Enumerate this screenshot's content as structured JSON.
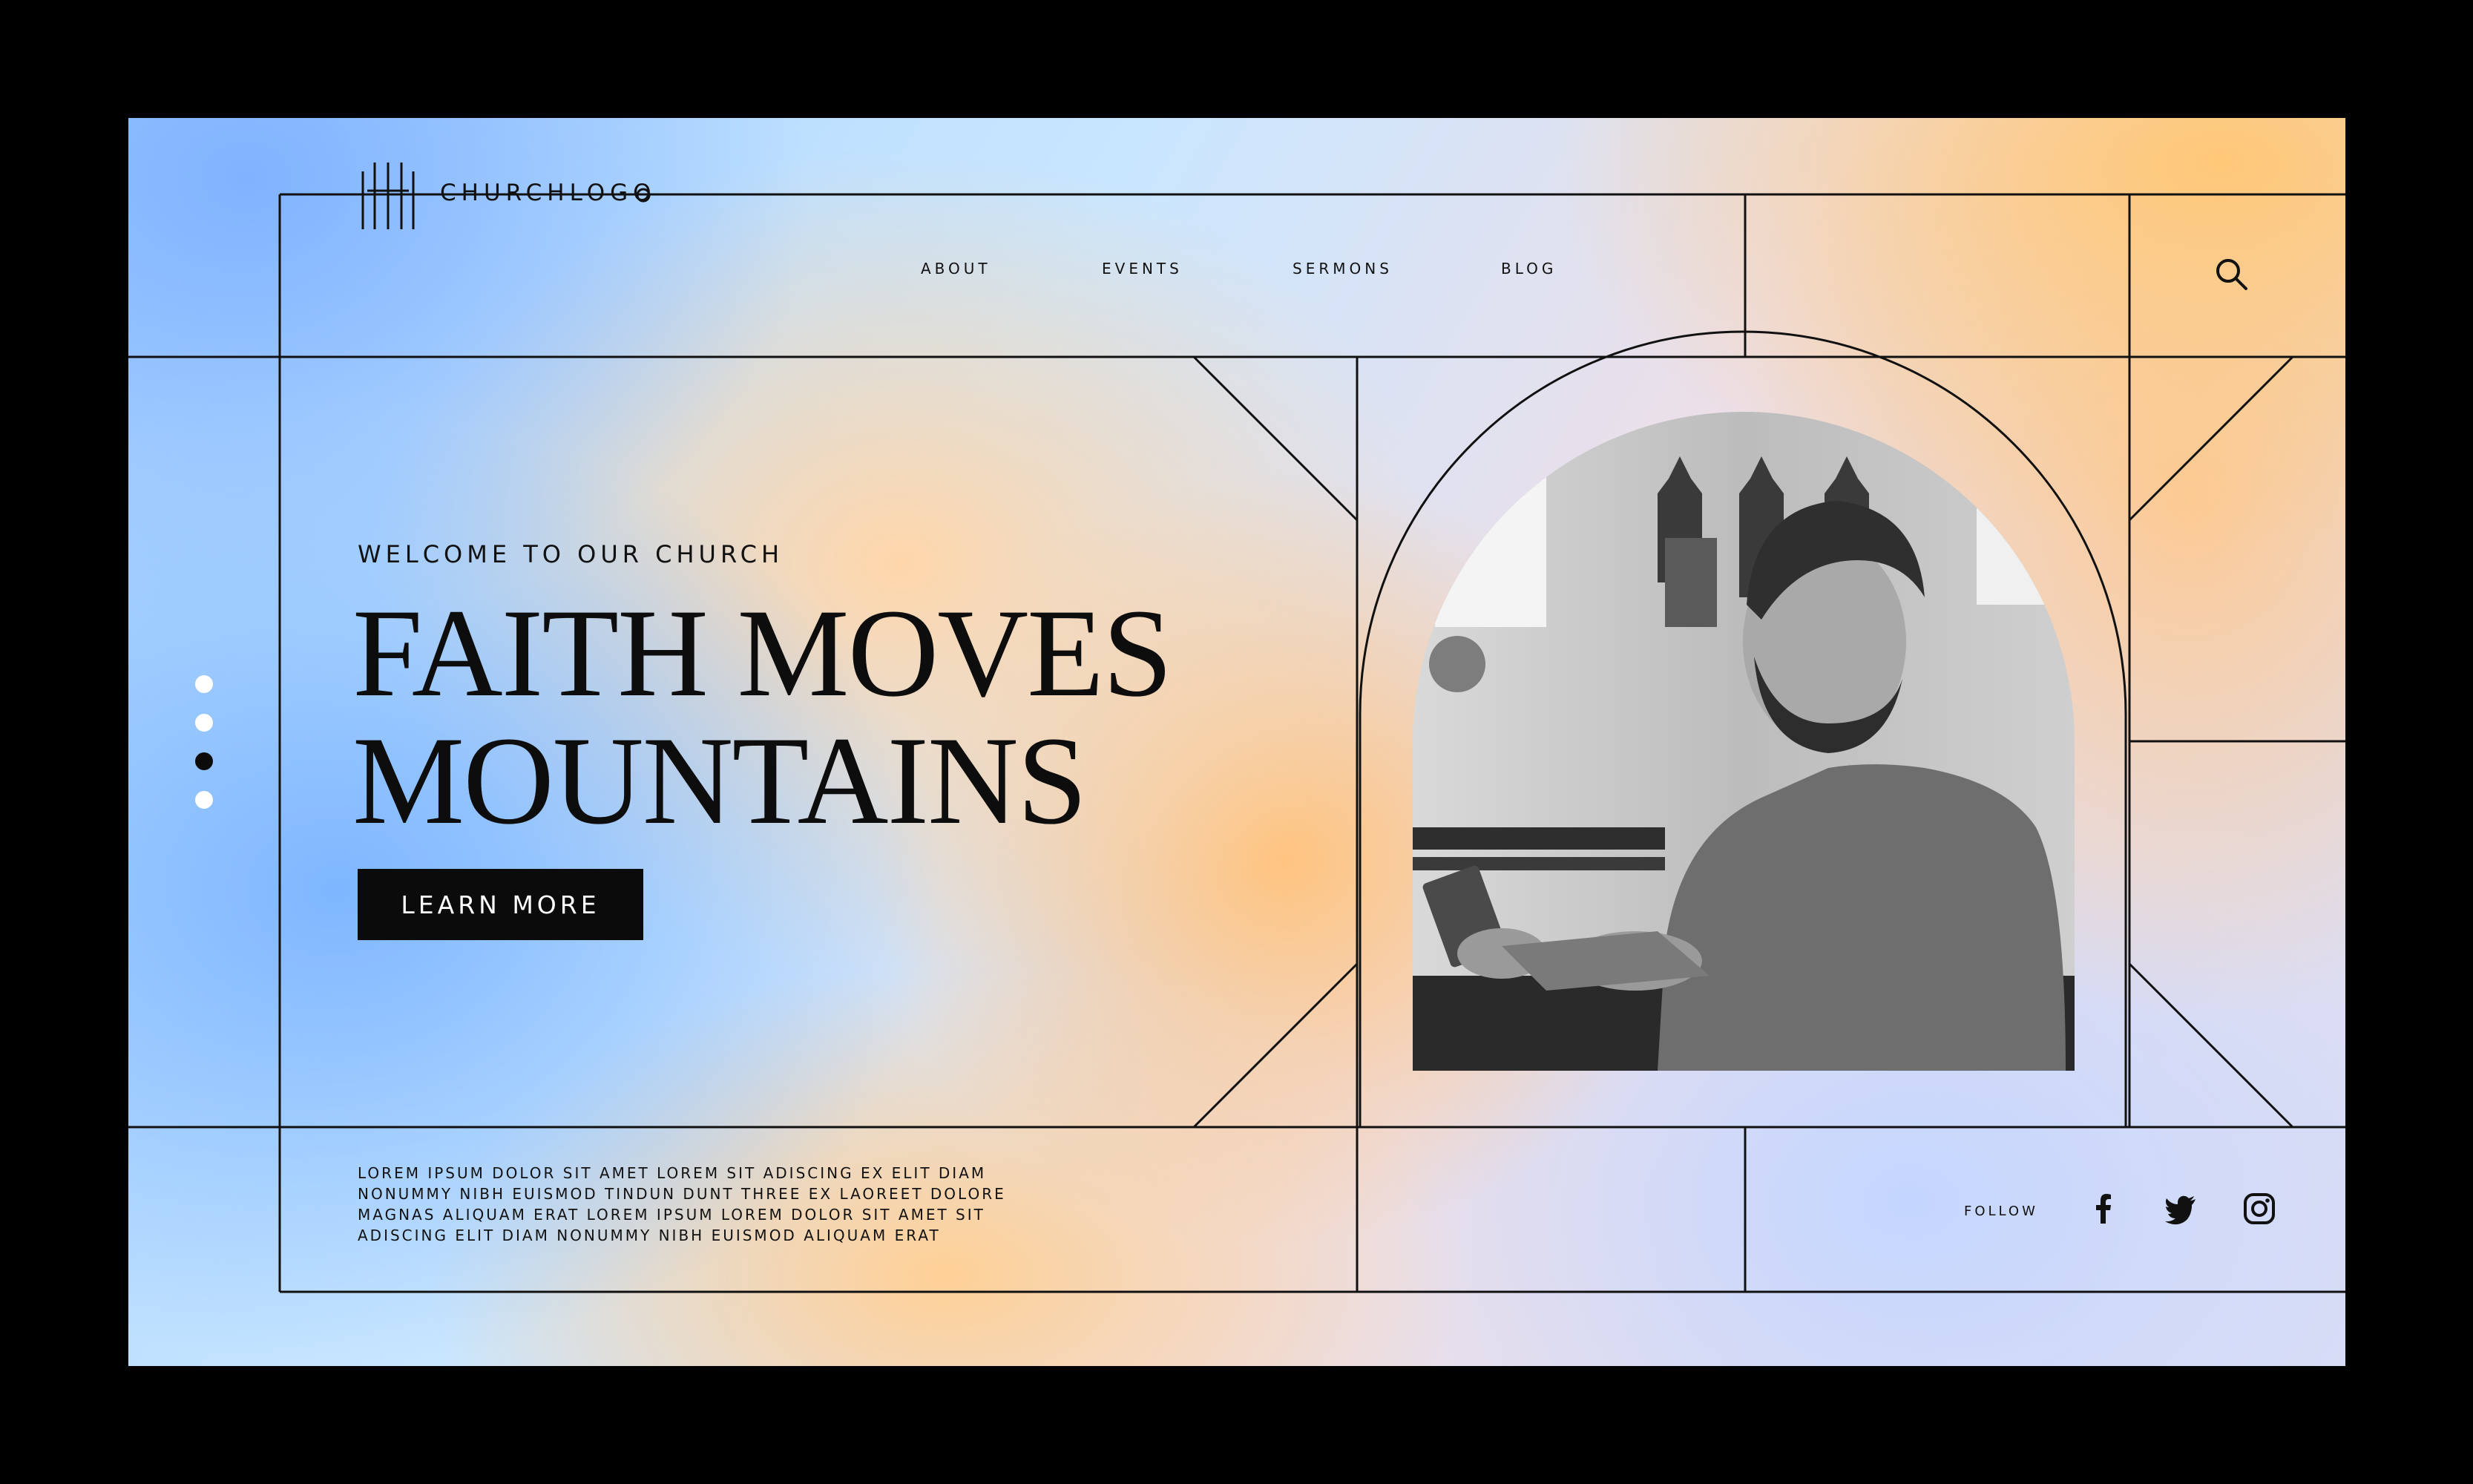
{
  "brand": {
    "logo_text": "CHURCHLOGO"
  },
  "nav": {
    "items": [
      {
        "label": "ABOUT"
      },
      {
        "label": "EVENTS"
      },
      {
        "label": "SERMONS"
      },
      {
        "label": "BLOG"
      }
    ]
  },
  "icons": {
    "search": "search-icon",
    "logo": "church-cross-logo-icon"
  },
  "hero": {
    "eyebrow": "WELCOME TO OUR CHURCH",
    "headline_line1": "FAITH MOVES",
    "headline_line2": "MOUNTAINS",
    "cta_label": "LEARN MORE",
    "image_alt": "Man with beard holding a book, seated in church pew"
  },
  "slider": {
    "count": 4,
    "active_index": 3
  },
  "footer": {
    "body_text": "LOREM IPSUM DOLOR SIT AMET LOREM SIT ADISCING EX ELIT DIAM NONUMMY NIBH EUISMOD TINDUN DUNT THREE EX LAOREET DOLORE MAGNAS ALIQUAM ERAT LOREM IPSUM LOREM DOLOR SIT AMET SIT ADISCING ELIT DIAM NONUMMY NIBH EUISMOD ALIQUAM ERAT",
    "follow_label": "FOLLOW",
    "social": [
      "facebook-icon",
      "twitter-icon",
      "instagram-icon"
    ]
  },
  "colors": {
    "ink": "#0b0b0b",
    "cta_bg": "#0b0b0b",
    "cta_text": "#ffffff",
    "line": "#111111"
  }
}
